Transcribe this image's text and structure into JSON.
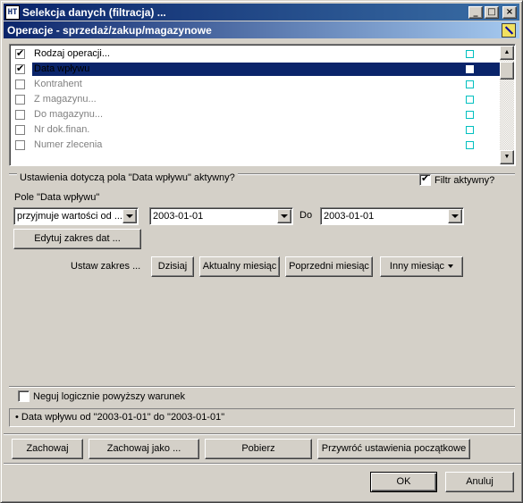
{
  "window": {
    "title": "Selekcja danych (filtracja) ...",
    "minimize_glyph": "_",
    "maximize_glyph": "□",
    "close_glyph": "×"
  },
  "section": {
    "title": "Operacje - sprzedaż/zakup/magazynowe",
    "icon": "clear-filter-icon"
  },
  "fields_list": {
    "items": [
      {
        "label": "Rodzaj operacji...",
        "checked": true,
        "active": true,
        "selected": false
      },
      {
        "label": "Data wpływu",
        "checked": true,
        "active": true,
        "selected": true
      },
      {
        "label": "Kontrahent",
        "checked": false,
        "active": false,
        "selected": false
      },
      {
        "label": "Z magazynu...",
        "checked": false,
        "active": false,
        "selected": false
      },
      {
        "label": "Do magazynu...",
        "checked": false,
        "active": false,
        "selected": false
      },
      {
        "label": "Nr dok.finan.",
        "checked": false,
        "active": false,
        "selected": false
      },
      {
        "label": "Numer zlecenia",
        "checked": false,
        "active": false,
        "selected": false
      }
    ]
  },
  "settings": {
    "group_label": "Ustawienia dotyczą pola \"Data wpływu\" aktywny?",
    "filter_active_label": "Filtr aktywny?",
    "filter_active": true,
    "field_label": "Pole \"Data wpływu\"",
    "condition_value": "przyjmuje wartości od ...",
    "date_from": "2003-01-01",
    "to_label": "Do",
    "date_to": "2003-01-01",
    "edit_range_button": "Edytuj zakres dat ...",
    "set_range_label": "Ustaw zakres ...",
    "today_button": "Dzisiaj",
    "current_month_button": "Aktualny miesiąc",
    "previous_month_button": "Poprzedni miesiąc",
    "other_month_button": "Inny miesiąc"
  },
  "negate": {
    "label": "Neguj logicznie powyższy warunek",
    "checked": false
  },
  "summary": {
    "text": "• Data wpływu od \"2003-01-01\" do \"2003-01-01\""
  },
  "actions": {
    "save": "Zachowaj",
    "save_as": "Zachowaj jako ...",
    "load": "Pobierz",
    "restore": "Przywróć ustawienia początkowe"
  },
  "dialog_buttons": {
    "ok": "OK",
    "cancel": "Anuluj"
  }
}
